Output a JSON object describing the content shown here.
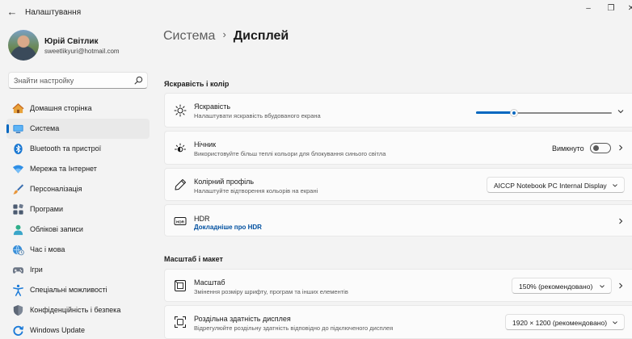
{
  "window": {
    "title": "Налаштування",
    "back": "←",
    "minimize": "–",
    "maximize": "❐",
    "close": "✕"
  },
  "user": {
    "name": "Юрій Світлик",
    "email": "sweetlikyuri@hotmail.com"
  },
  "search": {
    "placeholder": "Знайти настройку"
  },
  "nav": [
    {
      "label": "Домашня сторінка",
      "icon": "home-icon"
    },
    {
      "label": "Система",
      "icon": "monitor-icon",
      "active": true
    },
    {
      "label": "Bluetooth та пристрої",
      "icon": "bluetooth-icon"
    },
    {
      "label": "Мережа та Інтернет",
      "icon": "wifi-icon"
    },
    {
      "label": "Персоналізація",
      "icon": "brush-icon"
    },
    {
      "label": "Програми",
      "icon": "apps-icon"
    },
    {
      "label": "Облікові записи",
      "icon": "account-icon"
    },
    {
      "label": "Час і мова",
      "icon": "globe-clock-icon"
    },
    {
      "label": "Ігри",
      "icon": "gamepad-icon"
    },
    {
      "label": "Спеціальні можливості",
      "icon": "accessibility-icon"
    },
    {
      "label": "Конфіденційність і безпека",
      "icon": "shield-icon"
    },
    {
      "label": "Windows Update",
      "icon": "update-icon"
    }
  ],
  "breadcrumb": {
    "parent": "Система",
    "separator": "›",
    "current": "Дисплей"
  },
  "sections": {
    "brightness_color": "Яскравість і колір",
    "scale_layout": "Масштаб і макет"
  },
  "brightness": {
    "title": "Яскравість",
    "subtitle": "Налаштувати яскравість вбудованого екрана",
    "level": 0.28
  },
  "night_light": {
    "title": "Нічник",
    "subtitle": "Використовуйте більш теплі кольори для блокування синього світла",
    "state": "Вимкнуто",
    "on": false
  },
  "color_profile": {
    "title": "Колірний профіль",
    "subtitle": "Налаштуйте відтворення кольорів на екрані",
    "value": "AICCP Notebook PC Internal Display"
  },
  "hdr": {
    "title": "HDR",
    "link": "Докладніше про HDR"
  },
  "scale": {
    "title": "Масштаб",
    "subtitle": "Змінення розміру шрифту, програм та інших елементів",
    "value": "150% (рекомендовано)"
  },
  "resolution": {
    "title": "Роздільна здатність дисплея",
    "subtitle": "Відрегулюйте роздільну здатність відповідно до підключеного дисплея",
    "value": "1920 × 1200 (рекомендовано)"
  },
  "colors": {
    "accent": "#0067c0",
    "background": "#f3f3f3",
    "card": "#fbfbfb"
  }
}
